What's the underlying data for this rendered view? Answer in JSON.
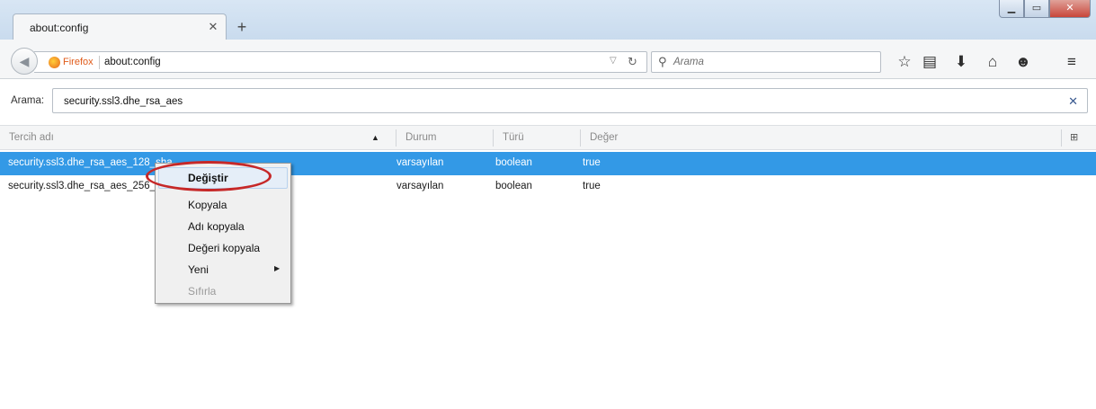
{
  "tab": {
    "title": "about:config"
  },
  "navbar": {
    "identity_label": "Firefox",
    "url": "about:config",
    "search_placeholder": "Arama"
  },
  "filter": {
    "label": "Arama:",
    "value": "security.ssl3.dhe_rsa_aes"
  },
  "columns": {
    "name": "Tercih adı",
    "status": "Durum",
    "type": "Türü",
    "value": "Değer"
  },
  "rows": [
    {
      "name": "security.ssl3.dhe_rsa_aes_128_sha",
      "status": "varsayılan",
      "type": "boolean",
      "value": "true"
    },
    {
      "name": "security.ssl3.dhe_rsa_aes_256_sha",
      "status": "varsayılan",
      "type": "boolean",
      "value": "true"
    }
  ],
  "context_menu": {
    "items": [
      {
        "label": "Değiştir"
      },
      {
        "label": "Kopyala"
      },
      {
        "label": "Adı kopyala"
      },
      {
        "label": "Değeri kopyala"
      },
      {
        "label": "Yeni"
      },
      {
        "label": "Sıfırla"
      }
    ]
  },
  "colors": {
    "selection": "#3399e6",
    "highlight_ellipse": "#c62828",
    "firefox_label": "#e05b1a"
  },
  "icons": [
    "back-arrow-icon",
    "firefox-logo-icon",
    "dropdown-icon",
    "reload-icon",
    "search-icon",
    "bookmark-star-icon",
    "reading-list-icon",
    "download-icon",
    "home-icon",
    "hello-icon",
    "hamburger-menu-icon",
    "close-icon",
    "sort-ascending-icon",
    "column-picker-icon"
  ]
}
